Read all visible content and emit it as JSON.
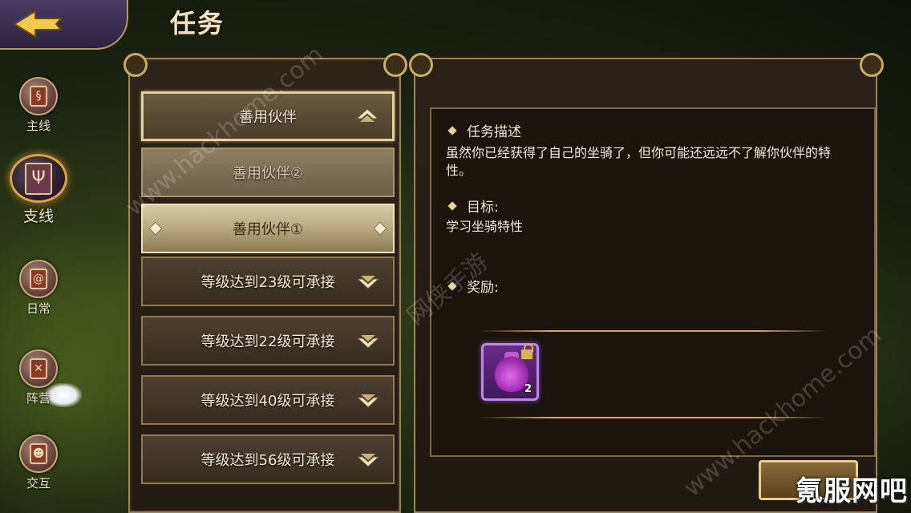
{
  "header": {
    "title": "任务",
    "back_label": ""
  },
  "sidebar": {
    "items": [
      {
        "label": "主线",
        "icon": "scroll-icon"
      },
      {
        "label": "支线",
        "icon": "trident-scroll-icon",
        "active": true
      },
      {
        "label": "日常",
        "icon": "swirl-scroll-icon"
      },
      {
        "label": "阵营",
        "icon": "crossed-swords-scroll-icon"
      },
      {
        "label": "交互",
        "icon": "people-scroll-icon"
      }
    ]
  },
  "quest_list": {
    "group_header": "善用伙伴",
    "sub_items": [
      {
        "label": "善用伙伴②"
      },
      {
        "label": "善用伙伴①"
      }
    ],
    "locked_groups": [
      {
        "label": "等级达到23级可承接"
      },
      {
        "label": "等级达到22级可承接"
      },
      {
        "label": "等级达到40级可承接"
      },
      {
        "label": "等级达到56级可承接"
      }
    ]
  },
  "detail": {
    "description_title": "任务描述",
    "description_text": "虽然你已经获得了自己的坐骑了，但你可能还远远不了解你伙伴的特性。",
    "goal_title": "目标:",
    "goal_text": "学习坐骑特性",
    "reward_title": "奖励:",
    "rewards": [
      {
        "icon": "purple-bag-icon",
        "count": "2",
        "locked": true
      }
    ]
  },
  "watermarks": {
    "corner": "氪服网吧",
    "diagonal_1": "www.hackhome.com",
    "diagonal_2": "网侠手游",
    "diagonal_3": "www.hackhome.com"
  },
  "colors": {
    "frame_gold": "#c9ab6a",
    "panel_bg": "#221b12",
    "text_light": "#f2ead6",
    "reward_purple": "#6a2a8a"
  }
}
